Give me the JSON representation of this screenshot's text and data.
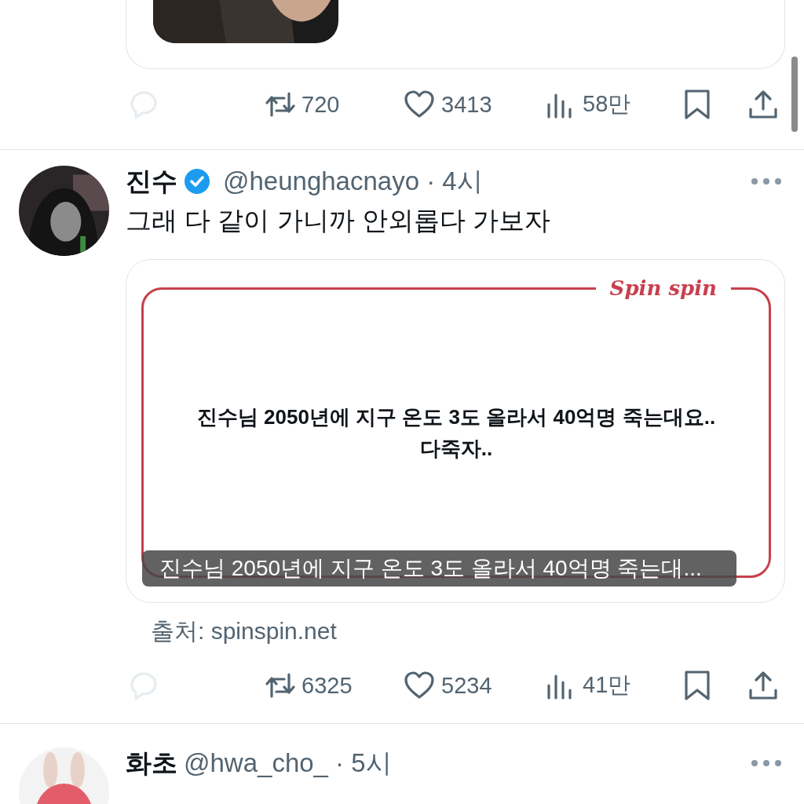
{
  "top_post": {
    "actions": {
      "retweets": "720",
      "likes": "3413",
      "views": "58만"
    }
  },
  "posts": [
    {
      "name": "진수",
      "verified": true,
      "meta": "@heunghacnayo · 4시",
      "text": "그래 다 같이 가니까 안외롭다 가보자",
      "card": {
        "logo": "Spin spin",
        "message": [
          "진수님 2050년에 지구 온도 3도 올라서 40억명 죽는대요..",
          "다죽자.."
        ],
        "caption": "진수님 2050년에 지구 온도 3도 올라서 40억명 죽는대..."
      },
      "source": "출처: spinspin.net",
      "actions": {
        "retweets": "6325",
        "likes": "5234",
        "views": "41만"
      }
    },
    {
      "name": "화초",
      "verified": false,
      "meta": "@hwa_cho_ · 5시"
    }
  ]
}
